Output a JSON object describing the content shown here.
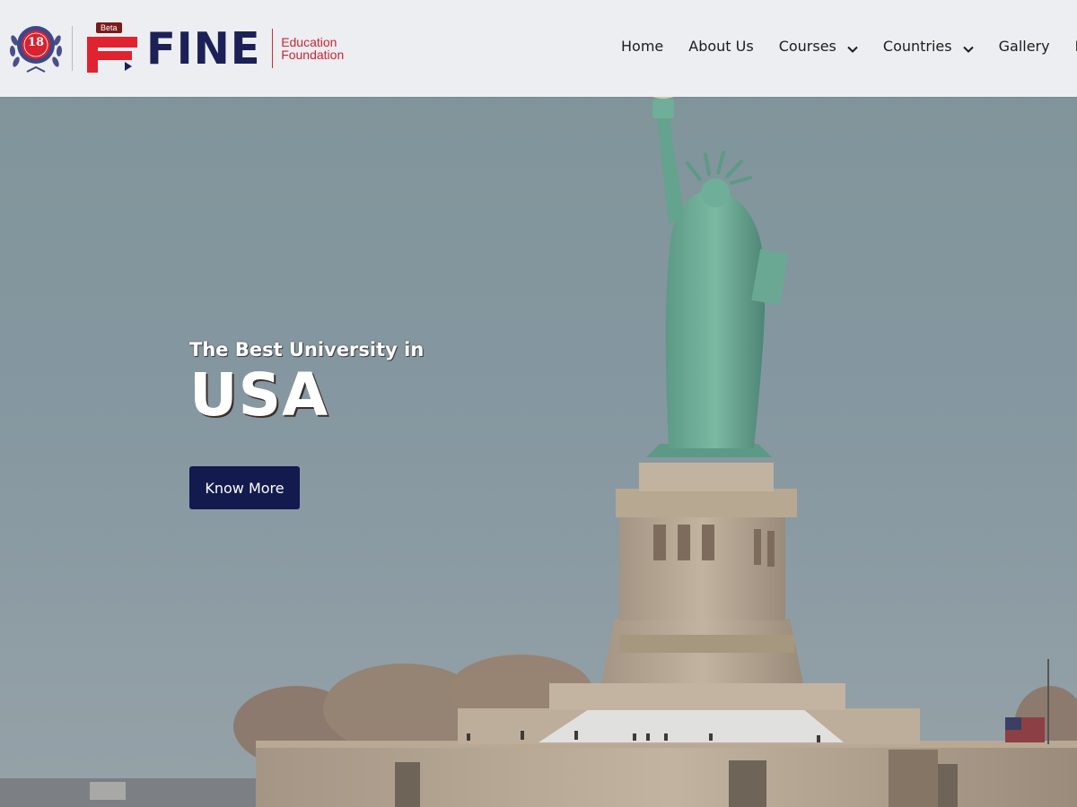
{
  "brand": {
    "badge": "Beta",
    "name": "FINE",
    "tagline_line1": "Education",
    "tagline_line2": "Foundation",
    "seal_number": "18",
    "colors": {
      "navy": "#1b2156",
      "red": "#d42131"
    }
  },
  "nav": {
    "items": [
      {
        "label": "Home",
        "has_dropdown": false
      },
      {
        "label": "About Us",
        "has_dropdown": false
      },
      {
        "label": "Courses",
        "has_dropdown": true
      },
      {
        "label": "Countries",
        "has_dropdown": true
      },
      {
        "label": "Gallery",
        "has_dropdown": false
      },
      {
        "label": "N",
        "has_dropdown": false
      }
    ],
    "dropdown_icon": "chevron-down-icon"
  },
  "hero": {
    "subtitle": "The Best University in",
    "title": "USA",
    "cta_label": "Know More",
    "background": "statue-of-liberty-photo",
    "cta_color": "#131a4e"
  }
}
